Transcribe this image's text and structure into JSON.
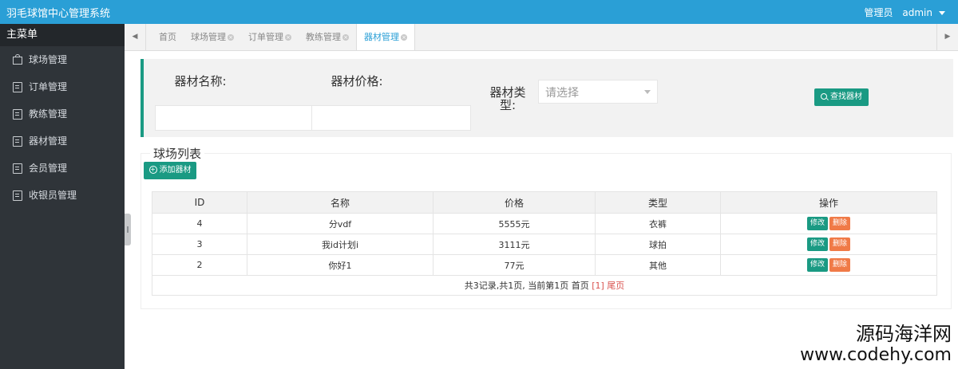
{
  "header": {
    "title": "羽毛球馆中心管理系统",
    "role": "管理员",
    "user": "admin"
  },
  "sidebar": {
    "heading": "主菜单",
    "items": [
      {
        "label": "球场管理",
        "icon": "bag-icon"
      },
      {
        "label": "订单管理",
        "icon": "document-icon"
      },
      {
        "label": "教练管理",
        "icon": "document-icon"
      },
      {
        "label": "器材管理",
        "icon": "document-icon"
      },
      {
        "label": "会员管理",
        "icon": "document-icon"
      },
      {
        "label": "收银员管理",
        "icon": "document-icon"
      }
    ]
  },
  "tabs": {
    "left_arrow": "◀",
    "right_arrow": "▶",
    "items": [
      {
        "label": "首页",
        "closable": false
      },
      {
        "label": "球场管理",
        "closable": true
      },
      {
        "label": "订单管理",
        "closable": true
      },
      {
        "label": "教练管理",
        "closable": true
      },
      {
        "label": "器材管理",
        "closable": true,
        "active": true
      }
    ]
  },
  "search": {
    "name_label": "器材名称:",
    "name_value": "",
    "price_label": "器材价格:",
    "price_value": "",
    "type_label": "器材类型:",
    "type_placeholder": "请选择",
    "search_button": "查找器材"
  },
  "list": {
    "legend": "球场列表",
    "add_button": "添加器材",
    "columns": [
      "ID",
      "名称",
      "价格",
      "类型",
      "操作"
    ],
    "rows": [
      {
        "id": "4",
        "name": "分vdf",
        "price": "5555元",
        "type": "衣裤"
      },
      {
        "id": "3",
        "name": "我id计划i",
        "price": "3111元",
        "type": "球拍"
      },
      {
        "id": "2",
        "name": "你好1",
        "price": "77元",
        "type": "其他"
      }
    ],
    "edit_label": "修改",
    "delete_label": "删除",
    "pager": {
      "summary": "共3记录,共1页, 当前第1页",
      "first": "首页",
      "current": "[1]",
      "last": "尾页"
    }
  },
  "watermark": {
    "line1": "源码海洋网",
    "line2": "www.codehy.com"
  },
  "colors": {
    "header": "#2a9fd6",
    "sidebar": "#2f3439",
    "accent": "#1a9a83",
    "danger": "#f07a47"
  }
}
